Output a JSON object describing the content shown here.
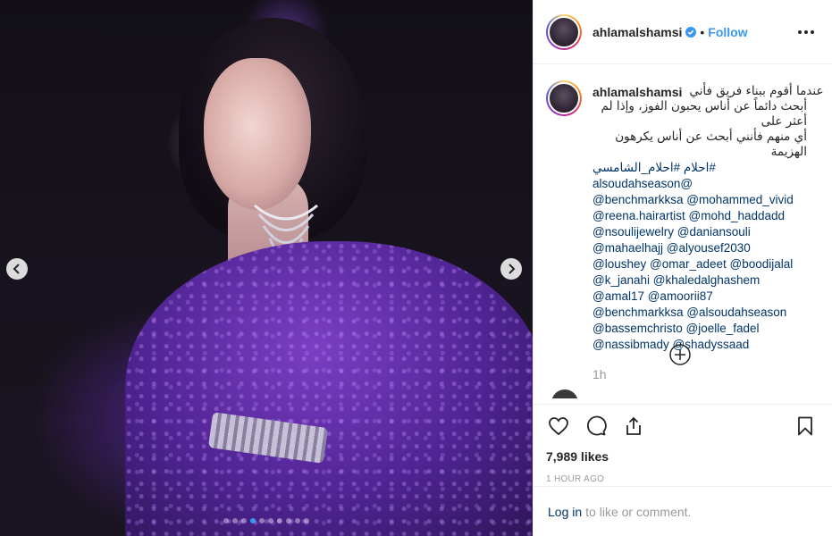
{
  "media": {
    "carousel_count": 10,
    "carousel_active_index": 3
  },
  "header": {
    "username": "ahlamalshamsi",
    "follow_label": "Follow",
    "separator": "•"
  },
  "caption": {
    "username": "ahlamalshamsi",
    "arabic_lines": [
      "عندما أقوم ببناء فريق فأني",
      "أبحث دائماً عن أناس يحبون الفوز، وإذا لم أعثر على",
      "أي منهم فأنني أبحث عن أناس يكرهون الهزيمة"
    ],
    "hashtag_line": "#احلام #احلام_الشامسي @alsoudahseason",
    "mention_lines": [
      "@benchmarkksa @mohammed_vivid",
      "@reena.hairartist @mohd_haddadd",
      "@nsoulijewelry @daniansouli",
      "@mahaelhajj @alyousef2030",
      "@loushey @omar_adeet @boodijalal",
      "@k_janahi @khaledalghashem",
      "@amal17 @amoorii87",
      "@benchmarkksa @alsoudahseason",
      "@bassemchristo @joelle_fadel",
      "@nassibmady @shadyssaad"
    ],
    "time": "1h"
  },
  "actions": {
    "likes": "7,989 likes",
    "ago": "1 HOUR AGO"
  },
  "login": {
    "link": "Log in",
    "rest": "to like or comment."
  },
  "icons": {
    "prev": "chevron-left-icon",
    "next": "chevron-right-icon",
    "like": "heart-icon",
    "comment": "comment-icon",
    "share": "share-icon",
    "save": "bookmark-icon",
    "load_more": "plus-circle-icon",
    "more": "more-options-icon",
    "verified": "verified-badge-icon"
  },
  "colors": {
    "link_blue": "#3897f0",
    "mention_navy": "#003569",
    "muted_gray": "#999999",
    "border": "#efefef"
  }
}
